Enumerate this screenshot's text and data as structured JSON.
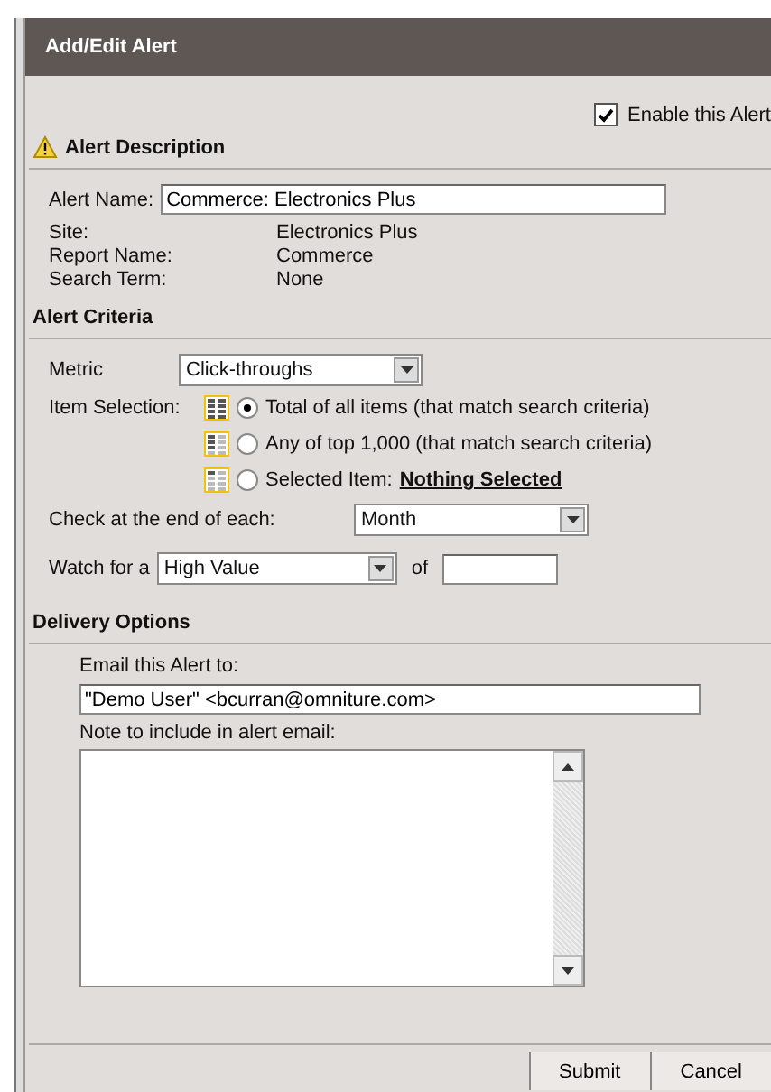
{
  "dialog": {
    "title": "Add/Edit Alert"
  },
  "enable": {
    "label": "Enable this Alert",
    "checked": true
  },
  "description": {
    "heading": "Alert Description",
    "name_label": "Alert Name:",
    "name_value": "Commerce: Electronics Plus",
    "info": [
      {
        "label": "Site:",
        "value": "Electronics Plus"
      },
      {
        "label": "Report Name:",
        "value": "Commerce"
      },
      {
        "label": "Search Term:",
        "value": "None"
      }
    ]
  },
  "criteria": {
    "heading": "Alert Criteria",
    "metric_label": "Metric",
    "metric_value": "Click-throughs",
    "item_label": "Item Selection:",
    "options": [
      {
        "label": "Total of all items (that match search criteria)",
        "selected": true
      },
      {
        "label": "Any of top 1,000 (that match search criteria)",
        "selected": false
      },
      {
        "label": "Selected Item:",
        "link": "Nothing Selected",
        "selected": false
      }
    ],
    "check_label": "Check at the end of each:",
    "check_value": "Month",
    "watch_label": "Watch for a",
    "watch_value": "High Value",
    "of_label": "of"
  },
  "delivery": {
    "heading": "Delivery Options",
    "email_label": "Email this Alert to:",
    "email_value": "\"Demo User\" <bcurran@omniture.com>",
    "note_label": "Note to include in alert email:"
  },
  "buttons": [
    "Submit",
    "Cancel"
  ]
}
